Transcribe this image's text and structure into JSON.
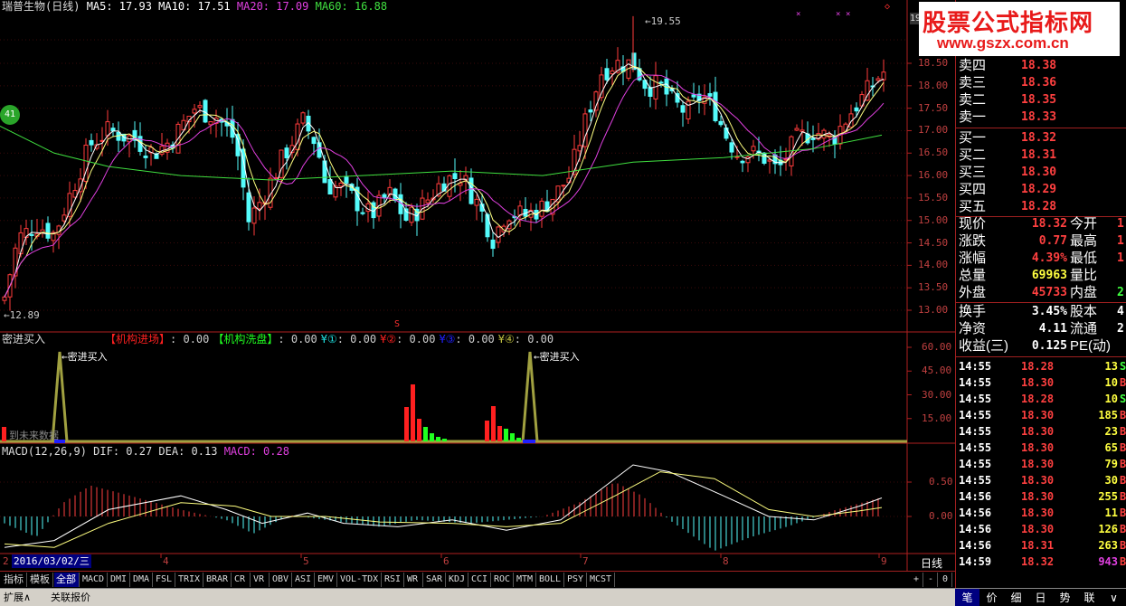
{
  "main": {
    "stock_name": "瑞普生物(日线)",
    "ma5": "MA5: 17.93",
    "ma10": "MA10: 17.51",
    "ma20": "MA20: 17.09",
    "ma60": "MA60: 16.88",
    "high_mark": "19.55",
    "low_mark": "12.89",
    "yaxis": [
      "18.50",
      "18.00",
      "17.50",
      "17.00",
      "16.50",
      "16.00",
      "15.50",
      "15.00",
      "14.50",
      "14.00",
      "13.50",
      "13.00"
    ],
    "badge": "41",
    "axis_top_label": "19",
    "marker_s": "S"
  },
  "indicator": {
    "name": "密进买入",
    "items": [
      {
        "label": "【机构进场】",
        "value": ": 0.00",
        "color": "#ff2020"
      },
      {
        "label": "【机构洗盘】",
        "value": ": 0.00",
        "color": "#20ff20"
      },
      {
        "label": "¥①",
        "value": ": 0.00",
        "color": "#20e0e0"
      },
      {
        "label": "¥②",
        "value": ": 0.00",
        "color": "#ff2020"
      },
      {
        "label": "¥③",
        "value": ": 0.00",
        "color": "#2020ff"
      },
      {
        "label": "¥④",
        "value": ": 0.00",
        "color": "#c0c040"
      }
    ],
    "yaxis": [
      "60.00",
      "45.00",
      "30.00",
      "15.00"
    ],
    "peak_label": "密进买入",
    "watermark": "到未来数据"
  },
  "macd": {
    "title": "MACD(12,26,9)",
    "dif": "DIF: 0.27",
    "dea": "DEA: 0.13",
    "macd": "MACD: 0.28",
    "yaxis": [
      "0.50",
      "0.00"
    ]
  },
  "xaxis": {
    "date_box": "2016/03/02/三",
    "months": [
      "4",
      "5",
      "6",
      "7",
      "8",
      "9"
    ],
    "first": "2",
    "period": "日线"
  },
  "tabs": [
    "指标",
    "模板",
    "全部",
    "MACD",
    "DMI",
    "DMA",
    "FSL",
    "TRIX",
    "BRAR",
    "CR",
    "VR",
    "OBV",
    "ASI",
    "EMV",
    "VOL-TDX",
    "RSI",
    "WR",
    "SAR",
    "KDJ",
    "CCI",
    "ROC",
    "MTM",
    "BOLL",
    "PSY",
    "MCST"
  ],
  "tab_controls": [
    "+",
    "-",
    "0"
  ],
  "status": {
    "left": [
      "扩展∧",
      "关联报价"
    ],
    "right_tabs": [
      "笔",
      "价",
      "细",
      "日",
      "势",
      "联",
      "∨"
    ]
  },
  "quote": {
    "asks": [
      {
        "label": "卖四",
        "price": "18.38"
      },
      {
        "label": "卖三",
        "price": "18.36"
      },
      {
        "label": "卖二",
        "price": "18.35"
      },
      {
        "label": "卖一",
        "price": "18.33"
      }
    ],
    "bids": [
      {
        "label": "买一",
        "price": "18.32"
      },
      {
        "label": "买二",
        "price": "18.31"
      },
      {
        "label": "买三",
        "price": "18.30"
      },
      {
        "label": "买四",
        "price": "18.29"
      },
      {
        "label": "买五",
        "price": "18.28"
      }
    ],
    "stats": [
      {
        "l1": "现价",
        "v1": "18.32",
        "c1": "#ff4040",
        "l2": "今开",
        "v2": "1",
        "c2": "#ff4040"
      },
      {
        "l1": "涨跌",
        "v1": "0.77",
        "c1": "#ff4040",
        "l2": "最高",
        "v2": "1",
        "c2": "#ff4040"
      },
      {
        "l1": "涨幅",
        "v1": "4.39%",
        "c1": "#ff4040",
        "l2": "最低",
        "v2": "1",
        "c2": "#ff4040"
      },
      {
        "l1": "总量",
        "v1": "69963",
        "c1": "#ffff40",
        "l2": "量比",
        "v2": "",
        "c2": "#ffff40"
      },
      {
        "l1": "外盘",
        "v1": "45733",
        "c1": "#ff4040",
        "l2": "内盘",
        "v2": "2",
        "c2": "#40ff40"
      }
    ],
    "stats2": [
      {
        "l1": "换手",
        "v1": "3.45%",
        "c1": "#ffffff",
        "l2": "股本",
        "v2": "4.",
        "c2": "#ffffff"
      },
      {
        "l1": "净资",
        "v1": "4.11",
        "c1": "#ffffff",
        "l2": "流通",
        "v2": "2.",
        "c2": "#ffffff"
      },
      {
        "l1": "收益(三)",
        "v1": "0.125",
        "c1": "#ffffff",
        "l2": "PE(动)",
        "v2": "",
        "c2": "#ffffff"
      }
    ],
    "ticks": [
      {
        "time": "14:55",
        "price": "18.28",
        "vol": "13",
        "flag": "S"
      },
      {
        "time": "14:55",
        "price": "18.30",
        "vol": "10",
        "flag": "B"
      },
      {
        "time": "14:55",
        "price": "18.28",
        "vol": "10",
        "flag": "S"
      },
      {
        "time": "14:55",
        "price": "18.30",
        "vol": "185",
        "flag": "B"
      },
      {
        "time": "14:55",
        "price": "18.30",
        "vol": "23",
        "flag": "B"
      },
      {
        "time": "14:55",
        "price": "18.30",
        "vol": "65",
        "flag": "B"
      },
      {
        "time": "14:55",
        "price": "18.30",
        "vol": "79",
        "flag": "B"
      },
      {
        "time": "14:55",
        "price": "18.30",
        "vol": "30",
        "flag": "B"
      },
      {
        "time": "14:56",
        "price": "18.30",
        "vol": "255",
        "flag": "B"
      },
      {
        "time": "14:56",
        "price": "18.30",
        "vol": "11",
        "flag": "B"
      },
      {
        "time": "14:56",
        "price": "18.30",
        "vol": "126",
        "flag": "B"
      },
      {
        "time": "14:56",
        "price": "18.31",
        "vol": "263",
        "flag": "B"
      },
      {
        "time": "14:59",
        "price": "18.32",
        "vol": "943",
        "flag": "B"
      }
    ]
  },
  "watermark": {
    "title": "股票公式指标网",
    "url": "www.gszx.com.cn"
  }
}
